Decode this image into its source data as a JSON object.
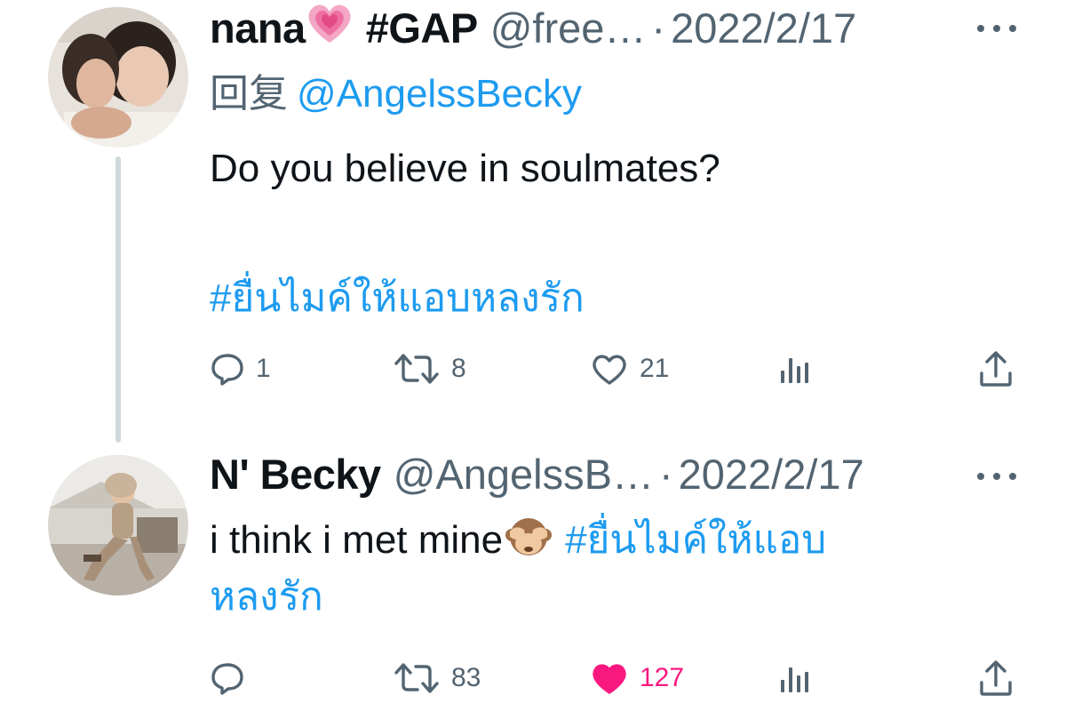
{
  "tweets": [
    {
      "display_name": "nana",
      "name_emoji": "growing-heart-emoji",
      "tag": "#GAP",
      "handle": "@free…",
      "separator": "·",
      "date": "2022/2/17",
      "reply_prefix": "回复",
      "reply_to": "@AngelssBecky",
      "text": "Do you believe in soulmates?",
      "hashtag": "#ยื่นไมค์ให้แอบหลงรัก",
      "replies": "1",
      "retweets": "8",
      "likes": "21",
      "liked": false
    },
    {
      "display_name": "N' Becky",
      "handle": "@AngelssB…",
      "separator": "·",
      "date": "2022/2/17",
      "text": "i think i met mine",
      "text_emoji": "see-no-evil-monkey-emoji",
      "hashtag_line1": "#ยื่นไมค์ให้แอบ",
      "hashtag_line2": "หลงรัก",
      "replies": "",
      "retweets": "83",
      "likes": "127",
      "liked": true
    }
  ],
  "colors": {
    "text": "#0f1419",
    "secondary": "#536471",
    "link": "#1d9bf0",
    "like_active": "#f91880",
    "thread_line": "#cfd9de"
  },
  "icons": [
    "reply-icon",
    "retweet-icon",
    "like-icon",
    "views-icon",
    "share-icon",
    "more-icon"
  ]
}
